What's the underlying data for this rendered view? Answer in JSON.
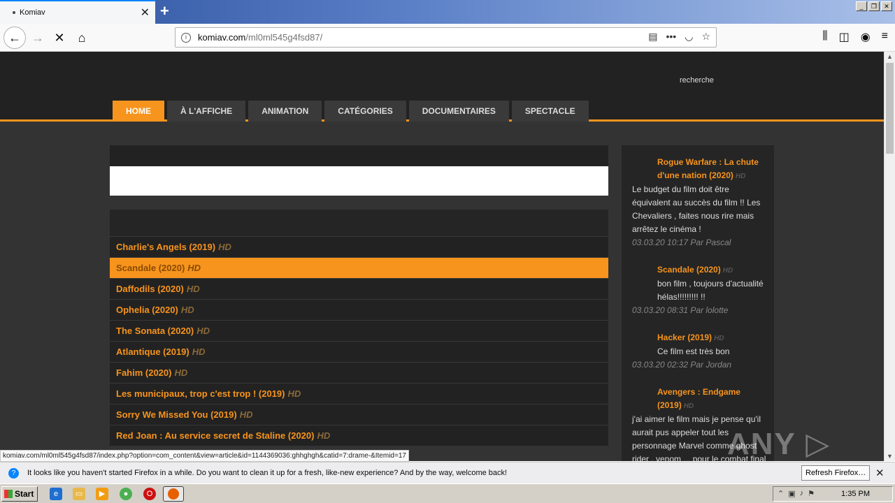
{
  "browser": {
    "tab_title": "Komiav",
    "tab_close": "✕",
    "new_tab": "+",
    "url_host": "komiav.com",
    "url_path": "/ml0ml545g4fsd87/",
    "status_url": "komiav.com/ml0ml545g4fsd87/index.php?option=com_content&view=article&id=1144369036:ghhghgh&catid=7:drame-&Itemid=17"
  },
  "site": {
    "search_label": "recherche",
    "menu": [
      {
        "label": "HOME",
        "active": true
      },
      {
        "label": "À L'AFFICHE"
      },
      {
        "label": "ANIMATION"
      },
      {
        "label": "CATÉGORIES"
      },
      {
        "label": "DOCUMENTAIRES"
      },
      {
        "label": "SPECTACLE"
      }
    ],
    "films": [
      {
        "title": "Charlie's Angels (2019)",
        "badge": "HD"
      },
      {
        "title": "Scandale (2020)",
        "badge": "HD",
        "highlight": true
      },
      {
        "title": "Daffodils (2020)",
        "badge": "HD"
      },
      {
        "title": "Ophelia (2020)",
        "badge": "HD"
      },
      {
        "title": "The Sonata (2020)",
        "badge": "HD"
      },
      {
        "title": "Atlantique (2019)",
        "badge": "HD"
      },
      {
        "title": "Fahim (2020)",
        "badge": "HD"
      },
      {
        "title": "Les municipaux, trop c'est trop ! (2019)",
        "badge": "HD"
      },
      {
        "title": "Sorry We Missed You (2019)",
        "badge": "HD"
      },
      {
        "title": "Red Joan : Au service secret de Staline (2020)",
        "badge": "HD"
      }
    ],
    "comments": [
      {
        "title": "Rogue Warfare : La chute d'une nation (2020)",
        "badge": "HD",
        "body": "Le budget du film doit être équivalent au succès du film !! Les Chevaliers , faites nous rire mais arrêtez le cinéma !",
        "meta": "03.03.20 10:17 Par Pascal"
      },
      {
        "title": "Scandale (2020)",
        "badge": "HD",
        "body": "bon film , toujours d'actualité hélas!!!!!!!!! !!",
        "meta": "03.03.20 08:31 Par lolotte"
      },
      {
        "title": "Hacker (2019)",
        "badge": "HD",
        "body": "Ce film est très bon",
        "meta": "03.03.20 02:32 Par Jordan"
      },
      {
        "title": "Avengers : Endgame (2019)",
        "badge": "HD",
        "body": "j'ai aimer le film mais je pense qu'il aurait pus appeler tout les personnage Marvel comme ghost rider , venom ... pour le combat final",
        "meta": ""
      }
    ]
  },
  "notification": {
    "message": "It looks like you haven't started Firefox in a while. Do you want to clean it up for a fresh, like-new experience? And by the way, welcome back!",
    "button": "Refresh Firefox…",
    "close": "✕"
  },
  "taskbar": {
    "start": "Start",
    "clock": "1:35 PM"
  },
  "watermark": "ANY RUN"
}
